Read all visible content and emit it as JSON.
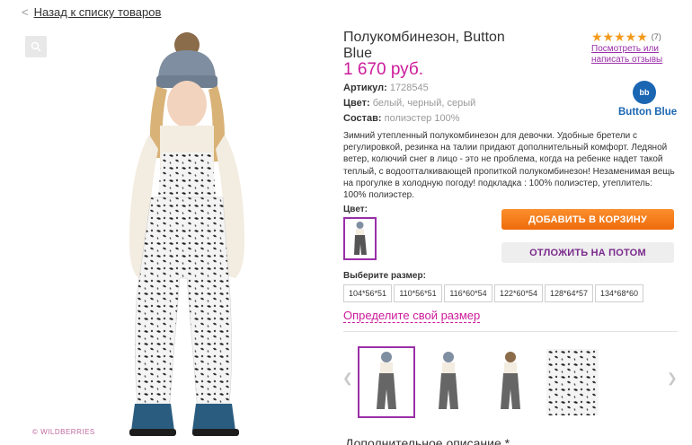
{
  "nav": {
    "back_label": "Назад к списку товаров"
  },
  "product": {
    "title": "Полукомбинезон, Button Blue",
    "price": "1 670 руб.",
    "article_label": "Артикул:",
    "article_value": "1728545",
    "color_label": "Цвет:",
    "color_value": "белый, черный, серый",
    "composition_label": "Состав:",
    "composition_value": "полиэстер 100%",
    "description": "Зимний утепленный полукомбинезон для девочки. Удобные бретели с регулировкой, резинка на талии придают дополнительный комфорт. Ледяной ветер, колючий снег в лицо - это не проблема, когда на ребенке надет такой теплый, с водоотталкивающей пропиткой полукомбинезон! Незаменимая вещь на прогулке в холодную погоду! подкладка : 100% полиэстер, утеплитель: 100% полиэстер."
  },
  "rating": {
    "stars": "★★★★★",
    "count": "(7)",
    "review_link": "Посмотреть или написать отзывы"
  },
  "brand": {
    "logo_text": "bb",
    "name": "Button Blue"
  },
  "color_picker": {
    "label": "Цвет:"
  },
  "actions": {
    "add_to_cart": "ДОБАВИТЬ В КОРЗИНУ",
    "save_for_later": "ОТЛОЖИТЬ НА ПОТОМ"
  },
  "sizes": {
    "label": "Выберите размер:",
    "options": [
      "104*56*51",
      "110*56*51",
      "116*60*54",
      "122*60*54",
      "128*64*57",
      "134*68*60"
    ],
    "size_guide_link": "Определите свой размер"
  },
  "gallery": {
    "prev_icon": "chevron-left-icon",
    "next_icon": "chevron-right-icon",
    "copyright": "© WILDBERRIES"
  },
  "more_description": {
    "title": "Дополнительное описание *"
  },
  "colors": {
    "price": "#cc1b9b",
    "accent_purple": "#9a2ea8",
    "cart_button": "#f47b1f",
    "star": "#f29a1a",
    "brand_blue": "#1a66b3"
  }
}
